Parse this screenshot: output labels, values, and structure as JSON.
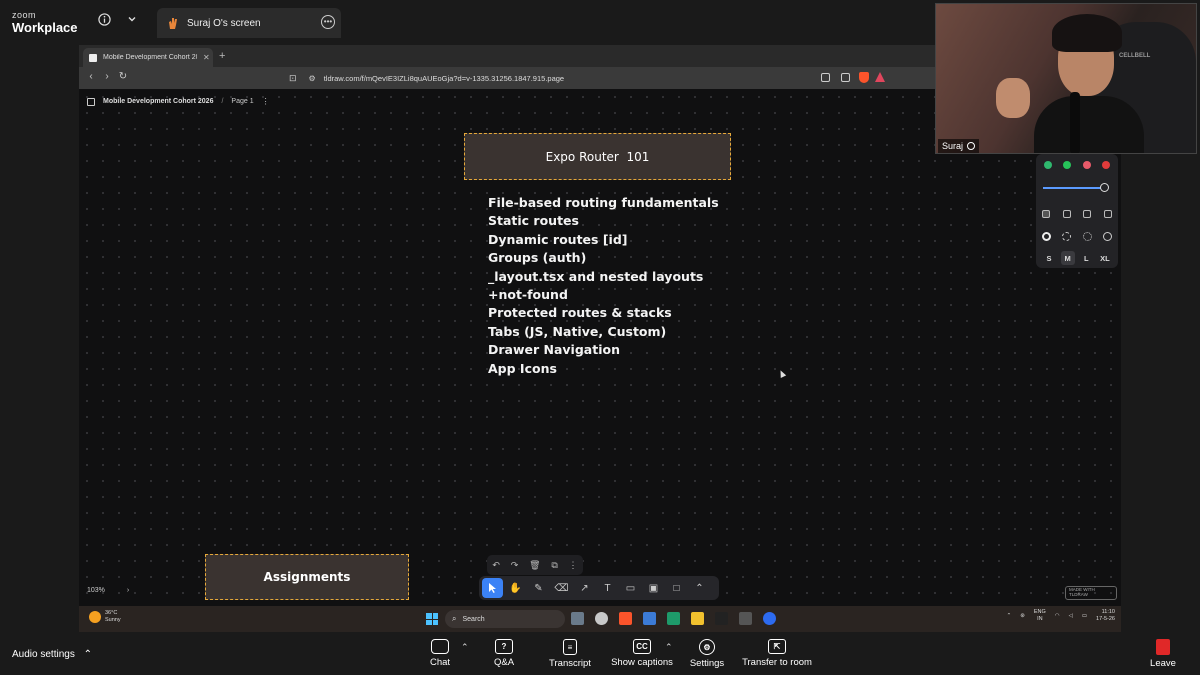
{
  "zoom_header": {
    "brand_small": "zoom",
    "brand_large": "Workplace",
    "share_tab_label": "Suraj O's screen"
  },
  "browser": {
    "tab_title": "Mobile Development Cohort 202...",
    "url": "tldraw.com/f/mQevIE3IZLi8quAUEoGja?d=v-1335.31256.1847.915.page"
  },
  "tldraw": {
    "doc_title": "Mobile Development Cohort 2026",
    "separator": "/",
    "page_name": "Page 1",
    "title_frame": "Expo Router  101",
    "topics": [
      "File-based routing fundamentals",
      "Static routes",
      "Dynamic routes [id]",
      "Groups (auth)",
      "_layout.tsx and nested layouts",
      "+not-found",
      "Protected routes & stacks",
      "Tabs (JS, Native, Custom)",
      "Drawer Navigation",
      "App Icons"
    ],
    "assignments_frame": "Assignments",
    "zoom_level": "103%",
    "made_with_line1": "MADE WITH",
    "made_with_line2": "TLDRAW",
    "style_panel": {
      "colors": [
        "#2fb86e",
        "#27c25a",
        "#e85a6a",
        "#e03b3b"
      ],
      "sizes": [
        "S",
        "M",
        "L",
        "XL"
      ],
      "selected_size": "M",
      "opacity": 1.0
    }
  },
  "taskbar": {
    "temperature": "36°C",
    "weather": "Sunny",
    "search_placeholder": "Search",
    "lang_line1": "ENG",
    "lang_line2": "IN",
    "time": "11:10",
    "date": "17-5-26"
  },
  "video": {
    "participant_name": "Suraj",
    "chair_brand": "CELLBELL"
  },
  "zoom_footer": {
    "audio_settings": "Audio settings",
    "chat": "Chat",
    "qa": "Q&A",
    "transcript": "Transcript",
    "captions": "Show captions",
    "settings": "Settings",
    "transfer": "Transfer to room",
    "leave": "Leave"
  }
}
